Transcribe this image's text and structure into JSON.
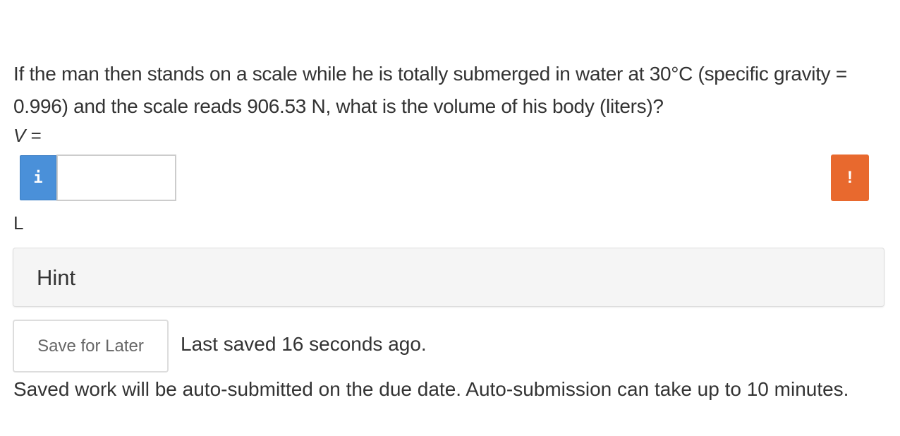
{
  "question": {
    "text": "If the man then stands on a scale while he is totally submerged in water at 30°C (specific gravity = 0.996) and the scale reads 906.53 N, what is the volume of his body (liters)?",
    "variable": "V",
    "equals": " ="
  },
  "answer": {
    "info_icon": "i",
    "value": "",
    "alert_icon": "!",
    "unit": "L"
  },
  "hint": {
    "label": "Hint"
  },
  "save": {
    "button_label": "Save for Later",
    "status": "Last saved 16 seconds ago."
  },
  "notice": {
    "text": "Saved work will be auto-submitted on the due date. Auto-submission can take up to 10 minutes."
  },
  "colors": {
    "info_blue": "#4a90d9",
    "alert_orange": "#e8692e",
    "hint_bg": "#f5f5f5"
  }
}
